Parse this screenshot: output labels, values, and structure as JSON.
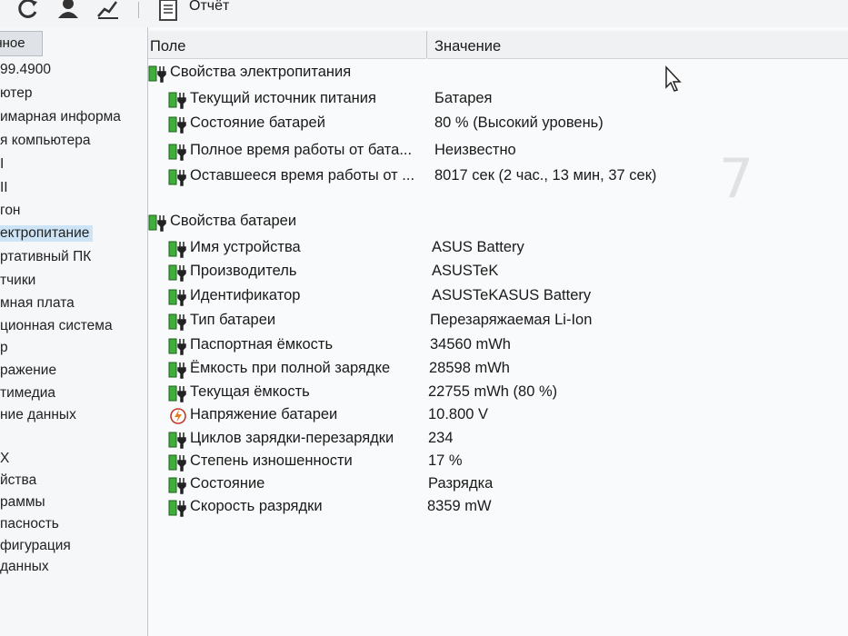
{
  "toolbar": {
    "report_label": "Отчёт",
    "icons": [
      "refresh-icon",
      "user-icon",
      "chart-icon",
      "report-icon"
    ]
  },
  "sidebar": {
    "header": "анное",
    "items": [
      {
        "label": "99.4900",
        "selected": false
      },
      {
        "label": "ютер",
        "selected": false
      },
      {
        "label": "имарная информа",
        "selected": false
      },
      {
        "label": "я компьютера",
        "selected": false
      },
      {
        "label": "I",
        "selected": false
      },
      {
        "label": "II",
        "selected": false
      },
      {
        "label": "гон",
        "selected": false
      },
      {
        "label": "ектропитание",
        "selected": true
      },
      {
        "label": "ртативный ПК",
        "selected": false
      },
      {
        "label": "тчики",
        "selected": false
      },
      {
        "label": "мная плата",
        "selected": false
      },
      {
        "label": "ционная система",
        "selected": false
      },
      {
        "label": "р",
        "selected": false
      },
      {
        "label": "ражение",
        "selected": false
      },
      {
        "label": "тимедиа",
        "selected": false
      },
      {
        "label": "ние данных",
        "selected": false
      },
      {
        "label": "X",
        "selected": false
      },
      {
        "label": "йства",
        "selected": false
      },
      {
        "label": "раммы",
        "selected": false
      },
      {
        "label": "пасность",
        "selected": false
      },
      {
        "label": "фигурация",
        "selected": false
      },
      {
        "label": "данных",
        "selected": false
      }
    ]
  },
  "report": {
    "columns": {
      "field": "Поле",
      "value": "Значение"
    },
    "groups": [
      {
        "title": "Свойства электропитания",
        "rows": [
          {
            "field": "Текущий источник питания",
            "value": "Батарея"
          },
          {
            "field": "Состояние батарей",
            "value": "80 % (Высокий уровень)"
          },
          {
            "field": "Полное время работы от бата...",
            "value": "Неизвестно"
          },
          {
            "field": "Оставшееся время работы от ...",
            "value": "8017 сек (2 час., 13 мин, 37 сек)"
          }
        ]
      },
      {
        "title": "Свойства батареи",
        "rows": [
          {
            "field": "Имя устройства",
            "value": "ASUS Battery",
            "icon": "battery-icon"
          },
          {
            "field": "Производитель",
            "value": "ASUSTeK",
            "icon": "battery-icon"
          },
          {
            "field": "Идентификатор",
            "value": "ASUSTeKASUS Battery",
            "icon": "battery-icon"
          },
          {
            "field": "Тип батареи",
            "value": "Перезаряжаемая Li-Ion",
            "icon": "battery-icon"
          },
          {
            "field": "Паспортная ёмкость",
            "value": "34560 mWh",
            "icon": "battery-icon"
          },
          {
            "field": "Ёмкость при полной зарядке",
            "value": "28598 mWh",
            "icon": "battery-icon"
          },
          {
            "field": "Текущая ёмкость",
            "value": "22755 mWh  (80 %)",
            "icon": "battery-icon"
          },
          {
            "field": "Напряжение батареи",
            "value": "10.800 V",
            "icon": "voltage-icon"
          },
          {
            "field": "Циклов зарядки-перезарядки",
            "value": "234",
            "icon": "battery-icon"
          },
          {
            "field": "Степень изношенности",
            "value": "17 %",
            "icon": "battery-icon"
          },
          {
            "field": "Состояние",
            "value": "Разрядка",
            "icon": "battery-icon"
          },
          {
            "field": "Скорость разрядки",
            "value": "8359 mW",
            "icon": "battery-icon"
          }
        ]
      }
    ]
  },
  "colors": {
    "battery_green": "#3fae3a",
    "selection": "#cde4f7",
    "panel_bg": "#f9fafb"
  }
}
